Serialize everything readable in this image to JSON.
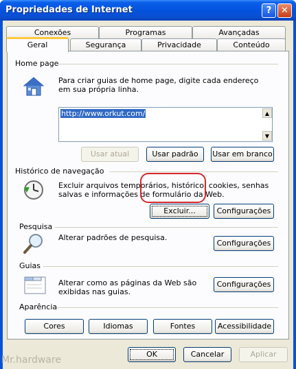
{
  "window": {
    "title": "Propriedades de Internet",
    "help_glyph": "?",
    "close_glyph": "✕"
  },
  "tabs_row1": [
    "Conexões",
    "Programas",
    "Avançadas"
  ],
  "tabs_row2": [
    "Geral",
    "Segurança",
    "Privacidade",
    "Conteúdo"
  ],
  "active_tab": "Geral",
  "home_page": {
    "label": "Home page",
    "icon": "home-icon",
    "description": "Para criar guias de home page, digite cada endereço em sua própria linha.",
    "url": "http://www.orkut.com/",
    "buttons": {
      "current": "Usar atual",
      "default": "Usar padrão",
      "blank": "Usar em branco"
    }
  },
  "history": {
    "label": "Histórico de navegação",
    "icon": "history-clock-icon",
    "description": "Excluir arquivos temporários, histórico, cookies, senhas salvas e informações de formulário da Web.",
    "delete_button": "Excluir...",
    "settings_button": "Configurações"
  },
  "search": {
    "label": "Pesquisa",
    "icon": "magnifier-icon",
    "description": "Alterar padrões de pesquisa.",
    "settings_button": "Configurações"
  },
  "tabs_group": {
    "label": "Guias",
    "icon": "tabbed-window-icon",
    "description": "Alterar como as páginas da Web são exibidas nas guias.",
    "settings_button": "Configurações"
  },
  "appearance": {
    "label": "Aparência",
    "buttons": [
      "Cores",
      "Idiomas",
      "Fontes",
      "Acessibilidade"
    ]
  },
  "footer": {
    "ok": "OK",
    "cancel": "Cancelar",
    "apply": "Aplicar"
  },
  "watermark": "Mr.hardware",
  "colors": {
    "title_bar": "#0453df",
    "dialog_bg": "#ece9d8",
    "highlight_ring": "#d8262b",
    "tab_accent": "#ffc83c"
  }
}
